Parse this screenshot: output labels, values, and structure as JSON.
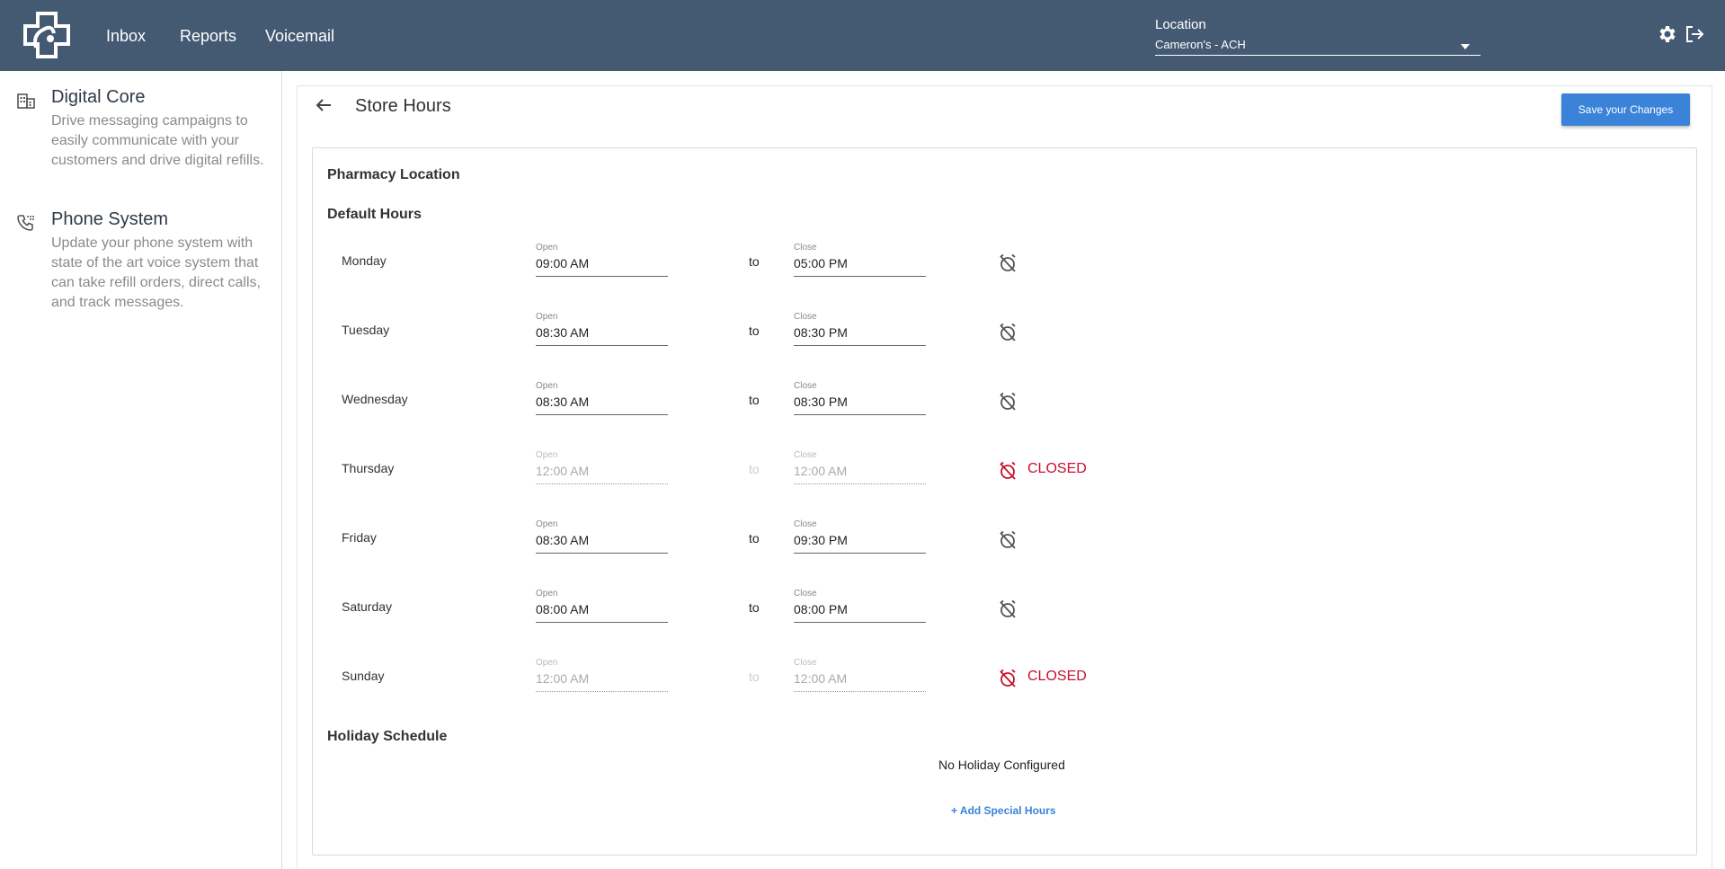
{
  "header": {
    "nav": [
      "Inbox",
      "Reports",
      "Voicemail"
    ],
    "location_label": "Location",
    "location_value": "Cameron's - ACH"
  },
  "sidebar": {
    "items": [
      {
        "title": "Digital Core",
        "desc": "Drive messaging campaigns to easily communicate with your customers and drive digital refills.",
        "icon": "building-icon"
      },
      {
        "title": "Phone System",
        "desc": "Update your phone system with state of the art voice system that can take refill orders, direct calls, and track messages.",
        "icon": "phone-icon"
      }
    ]
  },
  "page": {
    "title": "Store Hours",
    "save_label": "Save your Changes",
    "section_location": "Pharmacy Location",
    "section_default": "Default Hours",
    "section_holiday": "Holiday Schedule",
    "open_label": "Open",
    "close_label": "Close",
    "to_label": "to",
    "closed_label": "CLOSED",
    "no_holiday": "No Holiday Configured",
    "add_special": "+ Add Special Hours"
  },
  "hours": [
    {
      "day": "Monday",
      "open": "09:00 AM",
      "close": "05:00 PM",
      "closed": false
    },
    {
      "day": "Tuesday",
      "open": "08:30 AM",
      "close": "08:30 PM",
      "closed": false
    },
    {
      "day": "Wednesday",
      "open": "08:30 AM",
      "close": "08:30 PM",
      "closed": false
    },
    {
      "day": "Thursday",
      "open": "12:00 AM",
      "close": "12:00 AM",
      "closed": true
    },
    {
      "day": "Friday",
      "open": "08:30 AM",
      "close": "09:30 PM",
      "closed": false
    },
    {
      "day": "Saturday",
      "open": "08:00 AM",
      "close": "08:00 PM",
      "closed": false
    },
    {
      "day": "Sunday",
      "open": "12:00 AM",
      "close": "12:00 AM",
      "closed": true
    }
  ],
  "colors": {
    "header": "#445a73",
    "accent": "#3a83d9",
    "closed": "#c8102e"
  }
}
